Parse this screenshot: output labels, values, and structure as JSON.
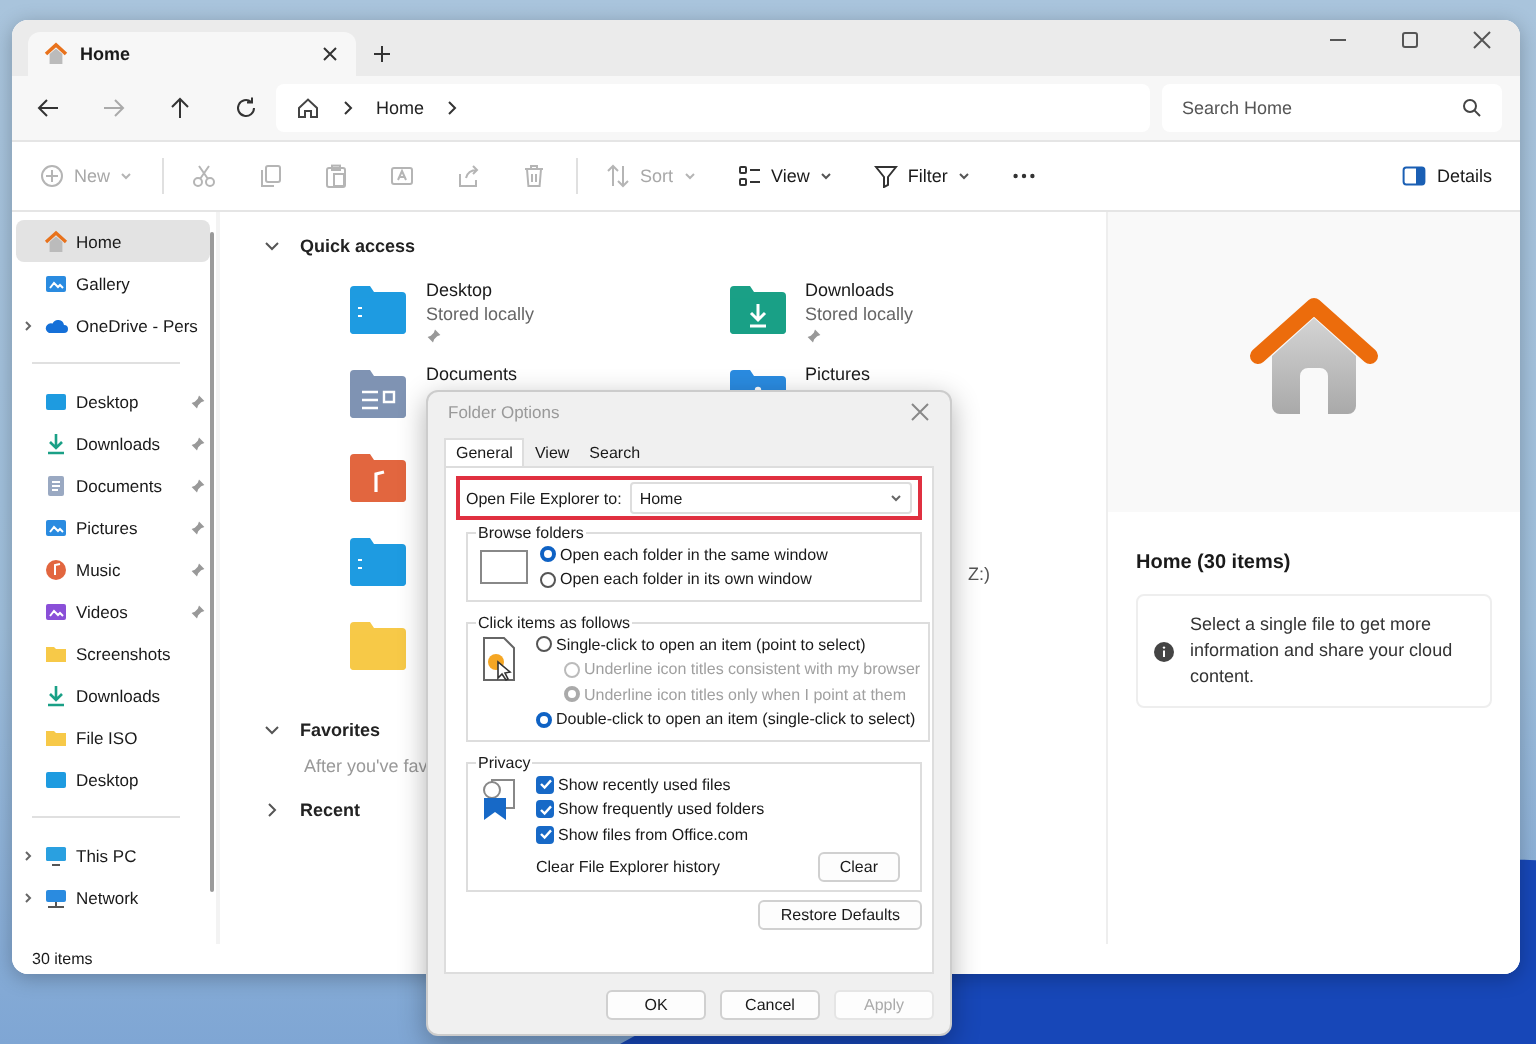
{
  "window": {
    "tab": {
      "title": "Home",
      "selected": true
    }
  },
  "nav": {
    "breadcrumb": [
      "Home"
    ],
    "search": {
      "placeholder": "Search Home"
    }
  },
  "toolbar": {
    "items": [
      {
        "kind": "new",
        "label": "New",
        "disabled": true
      },
      {
        "kind": "cut",
        "disabled": true
      },
      {
        "kind": "copy",
        "disabled": true
      },
      {
        "kind": "paste",
        "disabled": true
      },
      {
        "kind": "rename",
        "disabled": true
      },
      {
        "kind": "share",
        "disabled": true
      },
      {
        "kind": "delete",
        "disabled": true
      },
      {
        "kind": "sort",
        "label": "Sort",
        "disabled": true
      },
      {
        "kind": "view",
        "label": "View",
        "disabled": false
      },
      {
        "kind": "filter",
        "label": "Filter",
        "disabled": false
      },
      {
        "kind": "more",
        "disabled": false
      }
    ],
    "details": "Details"
  },
  "sidebar": {
    "sections": [
      {
        "items": [
          {
            "kind": "home",
            "label": "Home",
            "selected": true
          },
          {
            "kind": "gallery",
            "label": "Gallery",
            "selected": false
          },
          {
            "kind": "cloud",
            "label": "OneDrive - Pers",
            "selected": false,
            "expanded": false
          }
        ]
      },
      {
        "items": [
          {
            "kind": "desktop",
            "label": "Desktop",
            "selected": false,
            "pinned": true
          },
          {
            "kind": "downloads",
            "label": "Downloads",
            "selected": false,
            "pinned": true
          },
          {
            "kind": "documents",
            "label": "Documents",
            "selected": false,
            "pinned": true
          },
          {
            "kind": "pictures",
            "label": "Pictures",
            "selected": false,
            "pinned": true
          },
          {
            "kind": "music",
            "label": "Music",
            "selected": false,
            "pinned": true
          },
          {
            "kind": "videos",
            "label": "Videos",
            "selected": false,
            "pinned": true
          },
          {
            "kind": "folder",
            "label": "Screenshots",
            "selected": false,
            "pinned": false
          },
          {
            "kind": "downloads",
            "label": "Downloads",
            "selected": false,
            "pinned": false
          },
          {
            "kind": "folder",
            "label": "File ISO",
            "selected": false,
            "pinned": false
          },
          {
            "kind": "desktop",
            "label": "Desktop",
            "selected": false,
            "pinned": false
          }
        ]
      },
      {
        "items": [
          {
            "kind": "pc",
            "label": "This PC",
            "selected": false,
            "expanded": false
          },
          {
            "kind": "network",
            "label": "Network",
            "selected": false,
            "expanded": false
          }
        ]
      }
    ]
  },
  "quick_access": {
    "title": "Quick access",
    "expanded": true,
    "rows": [
      [
        {
          "kind": "desktop",
          "name": "Desktop",
          "subtitle": "Stored locally",
          "pinned": true
        },
        {
          "kind": "downloads",
          "name": "Downloads",
          "subtitle": "Stored locally",
          "pinned": true
        }
      ],
      [
        {
          "kind": "documents",
          "name": "Documents"
        },
        {
          "kind": "pictures",
          "name": "Pictures"
        }
      ],
      [
        {
          "kind": "music"
        }
      ],
      [
        {
          "kind": "desktop"
        },
        {
          "kind": "tail",
          "name": "Z:)"
        }
      ],
      [
        {
          "kind": "folder"
        }
      ]
    ]
  },
  "favorites": {
    "title": "Favorites",
    "expanded": true,
    "hint": "After you've fav"
  },
  "recent": {
    "title": "Recent",
    "expanded": false
  },
  "details": {
    "title": "Home (30 items)",
    "info": "Select a single file to get more information and share your cloud content."
  },
  "status_bar": {
    "count": "30 items"
  },
  "dialog": {
    "title": "Folder Options",
    "tabs": [
      {
        "label": "General",
        "selected": true
      },
      {
        "label": "View",
        "selected": false
      },
      {
        "label": "Search",
        "selected": false
      }
    ],
    "open_to": {
      "label": "Open File Explorer to:",
      "value": "Home",
      "highlighted": true
    },
    "browse": {
      "title": "Browse folders",
      "options": [
        {
          "label": "Open each folder in the same window",
          "selected": true
        },
        {
          "label": "Open each folder in its own window",
          "selected": false
        }
      ]
    },
    "click": {
      "title": "Click items as follows",
      "options": [
        {
          "label": "Single-click to open an item (point to select)",
          "selected": false,
          "disabled": false,
          "children": [
            {
              "label": "Underline icon titles consistent with my browser",
              "selected": false,
              "disabled": true
            },
            {
              "label": "Underline icon titles only when I point at them",
              "selected": true,
              "disabled": true
            }
          ]
        },
        {
          "label": "Double-click to open an item (single-click to select)",
          "selected": true,
          "disabled": false
        }
      ]
    },
    "privacy": {
      "title": "Privacy",
      "options": [
        {
          "label": "Show recently used files",
          "checked": true
        },
        {
          "label": "Show frequently used folders",
          "checked": true
        },
        {
          "label": "Show files from Office.com",
          "checked": true
        }
      ],
      "clear_label": "Clear File Explorer history",
      "clear_button": "Clear"
    },
    "restore_button": "Restore Defaults",
    "buttons": [
      {
        "label": "OK",
        "disabled": false
      },
      {
        "label": "Cancel",
        "disabled": false
      },
      {
        "label": "Apply",
        "disabled": true
      }
    ]
  }
}
